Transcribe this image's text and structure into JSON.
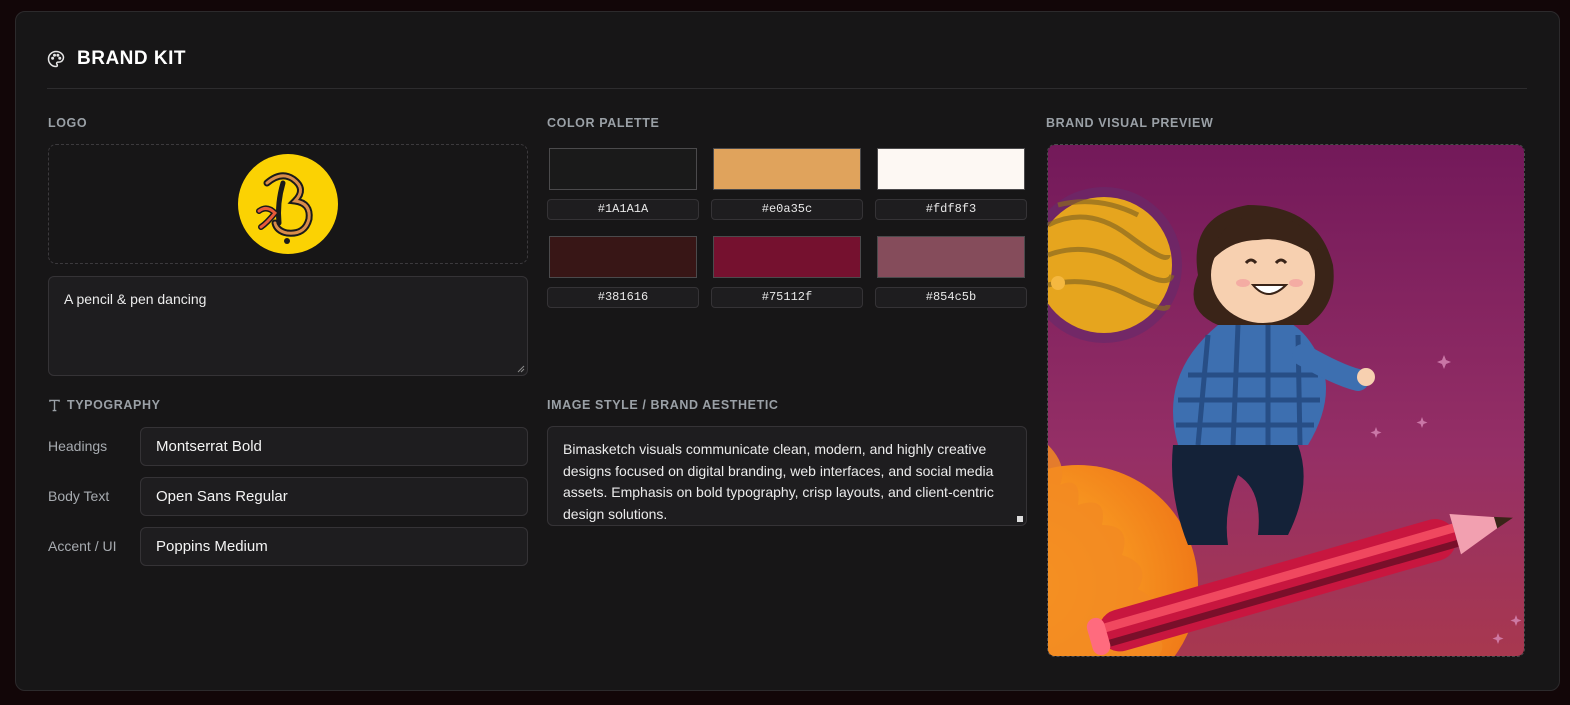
{
  "header": {
    "title": "BRAND KIT",
    "icon": "palette-icon"
  },
  "logo": {
    "section_label": "LOGO",
    "description": "A pencil & pen dancing",
    "colors": {
      "circle": "#fbd203",
      "stroke": "#1a1a1a",
      "accent": "#e85a3a"
    }
  },
  "typography": {
    "section_label": "TYPOGRAPHY",
    "rows": [
      {
        "label": "Headings",
        "value": "Montserrat Bold"
      },
      {
        "label": "Body Text",
        "value": "Open Sans Regular"
      },
      {
        "label": "Accent / UI",
        "value": "Poppins Medium"
      }
    ]
  },
  "palette": {
    "section_label": "COLOR PALETTE",
    "swatches": [
      {
        "hex": "#1A1A1A",
        "color": "#1A1A1A"
      },
      {
        "hex": "#e0a35c",
        "color": "#e0a35c"
      },
      {
        "hex": "#fdf8f3",
        "color": "#fdf8f3"
      },
      {
        "hex": "#381616",
        "color": "#381616"
      },
      {
        "hex": "#75112f",
        "color": "#75112f"
      },
      {
        "hex": "#854c5b",
        "color": "#854c5b"
      }
    ]
  },
  "image_style": {
    "section_label": "IMAGE STYLE / BRAND AESTHETIC",
    "text": "Bimasketch visuals communicate clean, modern, and highly creative designs focused on digital branding, web interfaces, and social media assets. Emphasis on bold typography, crisp layouts, and client-centric design solutions."
  },
  "preview": {
    "section_label": "BRAND VISUAL PREVIEW",
    "image": "illustration-character-riding-pencil"
  }
}
